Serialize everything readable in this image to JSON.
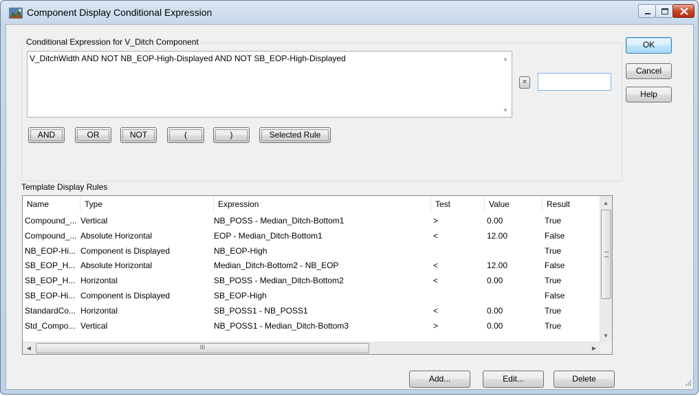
{
  "window": {
    "title": "Component Display Conditional Expression",
    "icon": "app-landscape-icon"
  },
  "expression_group": {
    "label": "Conditional Expression for V_Ditch Component",
    "expression_text": "V_DitchWidth AND NOT NB_EOP-High-Displayed AND NOT SB_EOP-High-Displayed",
    "equals_label": "=",
    "result_value": "",
    "operators": [
      "AND",
      "OR",
      "NOT",
      "(",
      ")",
      "Selected Rule"
    ]
  },
  "dialog_buttons": {
    "ok": "OK",
    "cancel": "Cancel",
    "help": "Help"
  },
  "rules": {
    "label": "Template Display Rules",
    "columns": [
      "Name",
      "Type",
      "Expression",
      "Test",
      "Value",
      "Result"
    ],
    "rows": [
      [
        "Compound_...",
        "Vertical",
        "NB_POSS - Median_Ditch-Bottom1",
        ">",
        "0.00",
        "True"
      ],
      [
        "Compound_...",
        "Absolute Horizontal",
        "EOP - Median_Ditch-Bottom1",
        "<",
        "12.00",
        "False"
      ],
      [
        "NB_EOP-Hi...",
        "Component is Displayed",
        "NB_EOP-High",
        "",
        "",
        "True"
      ],
      [
        "SB_EOP_H...",
        "Absolute Horizontal",
        "Median_Ditch-Bottom2 - NB_EOP",
        "<",
        "12.00",
        "False"
      ],
      [
        "SB_EOP_H...",
        "Horizontal",
        "SB_POSS - Median_Ditch-Bottom2",
        "<",
        "0.00",
        "True"
      ],
      [
        "SB_EOP-Hi...",
        "Component is Displayed",
        "SB_EOP-High",
        "",
        "",
        "False"
      ],
      [
        "StandardCo...",
        "Horizontal",
        "SB_POSS1 - NB_POSS1",
        "<",
        "0.00",
        "True"
      ],
      [
        "Std_Compo...",
        "Vertical",
        "NB_POSS1 - Median_Ditch-Bottom3",
        ">",
        "0.00",
        "True"
      ]
    ],
    "scroll_glyph": "III"
  },
  "rule_buttons": {
    "add": "Add...",
    "edit": "Edit...",
    "delete": "Delete"
  },
  "colors": {
    "title_gradient_top": "#dbe6f3",
    "close_button": "#c8452c",
    "default_button_border": "#3c7fb1"
  }
}
